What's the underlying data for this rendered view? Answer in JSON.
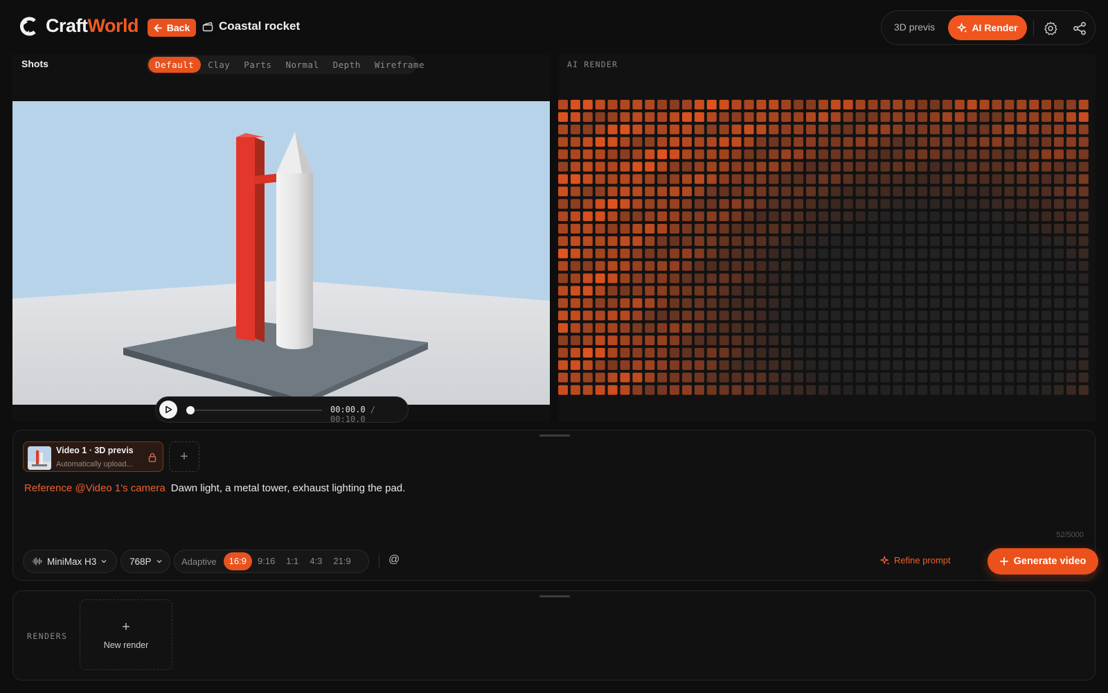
{
  "header": {
    "logo": {
      "craft": "Craft",
      "world": "World"
    },
    "back_label": "Back",
    "project_name": "Coastal rocket",
    "mode_previs": "3D previs",
    "mode_ai": "AI Render"
  },
  "shots": {
    "title": "Shots",
    "view_tabs": [
      "Default",
      "Clay",
      "Parts",
      "Normal",
      "Depth",
      "Wireframe"
    ],
    "active_tab": "Default"
  },
  "playback": {
    "current_time": "00:00.0",
    "total_time": " / 00:10.0",
    "progress": 0
  },
  "ai_render": {
    "label": "AI RENDER"
  },
  "prompt": {
    "reference": {
      "title": "Video 1 · 3D previs",
      "subtitle": "Automatically upload..."
    },
    "add_label": "+",
    "ref_text": "Reference @Video 1's camera",
    "text": "Dawn light, a metal tower, exhaust lighting the pad.",
    "char_count": "52/5000"
  },
  "toolbar": {
    "model": "MiniMax H3",
    "resolution": "768P",
    "ratio_label": "Adaptive",
    "ratios": [
      "16:9",
      "9:16",
      "1:1",
      "4:3",
      "21:9"
    ],
    "active_ratio": "16:9",
    "at_symbol": "@",
    "refine_label": "Refine prompt",
    "generate_label": "Generate video"
  },
  "renders": {
    "label": "RENDERS",
    "new_plus": "+",
    "new_label": "New render"
  },
  "colors": {
    "accent": "#ec511c",
    "background": "#0e0e0e",
    "panel": "#111111"
  }
}
